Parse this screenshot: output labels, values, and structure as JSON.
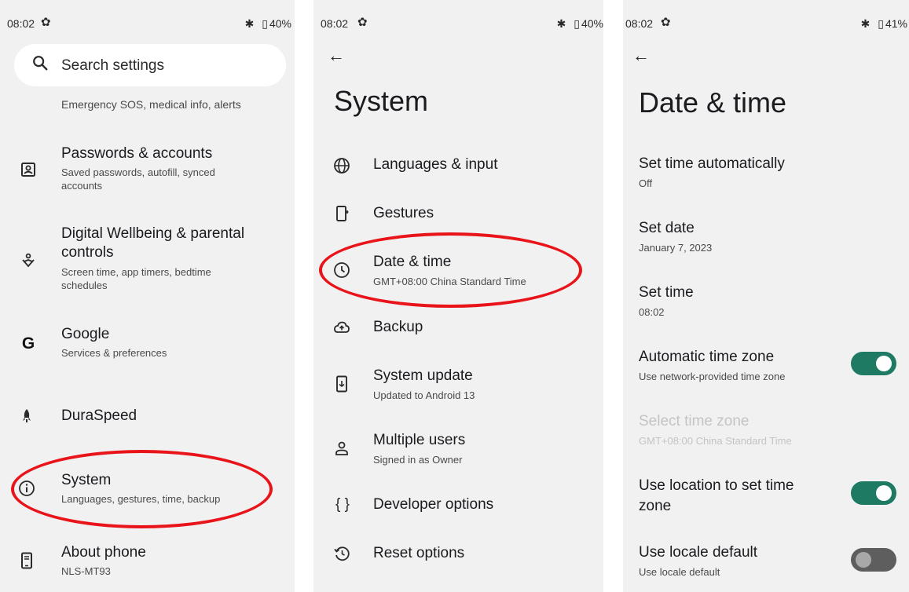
{
  "screen1": {
    "status": {
      "time": "08:02",
      "bluetooth": "✱",
      "battery": "40%"
    },
    "search": {
      "placeholder": "Search settings"
    },
    "partial_item": {
      "subtitle": "Emergency SOS, medical info, alerts"
    },
    "items": [
      {
        "title": "Passwords & accounts",
        "subtitle": "Saved passwords, autofill, synced accounts",
        "icon": "account-box-icon"
      },
      {
        "title": "Digital Wellbeing & parental controls",
        "subtitle": "Screen time, app timers, bedtime schedules",
        "icon": "wellbeing-icon"
      },
      {
        "title": "Google",
        "subtitle": "Services & preferences",
        "icon": "google-icon"
      },
      {
        "title": "DuraSpeed",
        "subtitle": "",
        "icon": "rocket-icon"
      },
      {
        "title": "System",
        "subtitle": "Languages, gestures, time, backup",
        "icon": "info-icon"
      },
      {
        "title": "About phone",
        "subtitle": "NLS-MT93",
        "icon": "phone-icon"
      }
    ]
  },
  "screen2": {
    "status": {
      "time": "08:02",
      "bluetooth": "✱",
      "battery": "40%"
    },
    "title": "System",
    "items": [
      {
        "title": "Languages & input",
        "subtitle": "",
        "icon": "globe-icon"
      },
      {
        "title": "Gestures",
        "subtitle": "",
        "icon": "gestures-icon"
      },
      {
        "title": "Date & time",
        "subtitle": "GMT+08:00 China Standard Time",
        "icon": "clock-icon"
      },
      {
        "title": "Backup",
        "subtitle": "",
        "icon": "cloud-upload-icon"
      },
      {
        "title": "System update",
        "subtitle": "Updated to Android 13",
        "icon": "system-update-icon"
      },
      {
        "title": "Multiple users",
        "subtitle": "Signed in as Owner",
        "icon": "person-icon"
      },
      {
        "title": "Developer options",
        "subtitle": "",
        "icon": "braces-icon"
      },
      {
        "title": "Reset options",
        "subtitle": "",
        "icon": "history-icon"
      }
    ]
  },
  "screen3": {
    "status": {
      "time": "08:02",
      "bluetooth": "✱",
      "battery": "41%"
    },
    "title": "Date & time",
    "items": [
      {
        "title": "Set time automatically",
        "subtitle": "Off"
      },
      {
        "title": "Set date",
        "subtitle": "January 7, 2023"
      },
      {
        "title": "Set time",
        "subtitle": "08:02"
      },
      {
        "title": "Automatic time zone",
        "subtitle": "Use network-provided time zone",
        "toggle": "on"
      },
      {
        "title": "Select time zone",
        "subtitle": "GMT+08:00 China Standard Time",
        "disabled": true
      },
      {
        "title": "Use location to set time zone",
        "subtitle": "",
        "toggle": "on"
      },
      {
        "title": "Use locale default",
        "subtitle": "Use locale default",
        "toggle": "off"
      }
    ]
  },
  "colors": {
    "background": "#f1f1f1",
    "toggle_on": "#1e7a62",
    "toggle_off": "#5e5e5e",
    "highlight_oval": "#e8141a"
  }
}
